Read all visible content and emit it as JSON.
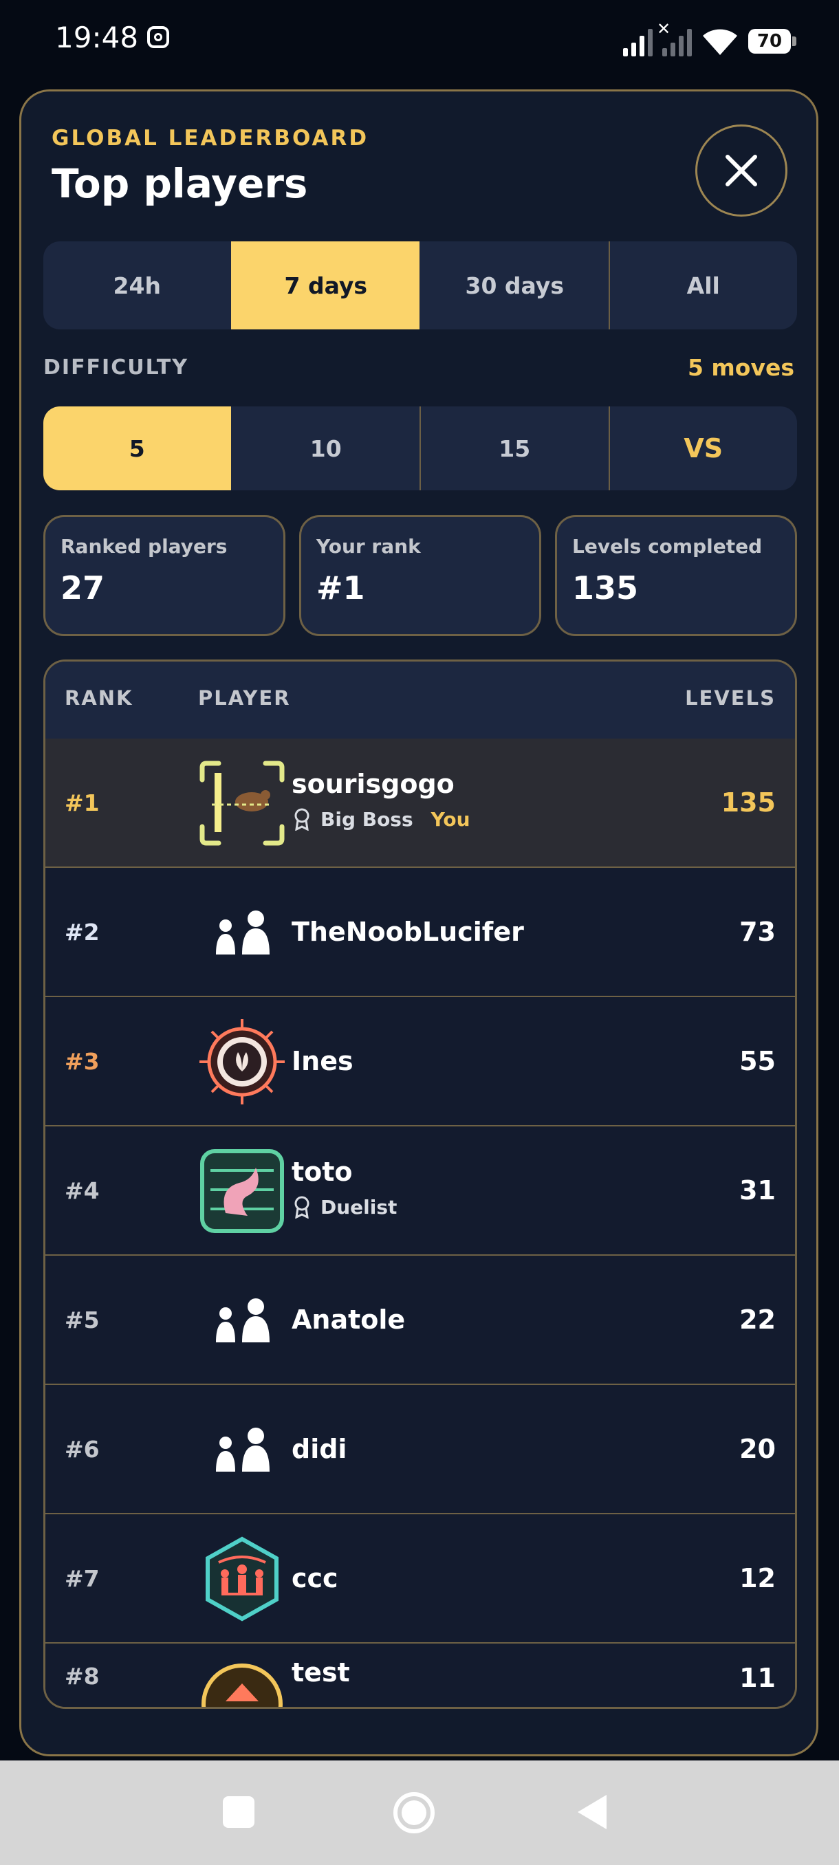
{
  "status_bar": {
    "time": "19:48",
    "battery": "70"
  },
  "header": {
    "kicker": "GLOBAL LEADERBOARD",
    "title": "Top players"
  },
  "time_filter": {
    "options": [
      "24h",
      "7 days",
      "30 days",
      "All"
    ],
    "selected": "7 days"
  },
  "difficulty": {
    "label": "DIFFICULTY",
    "summary": "5 moves",
    "options": [
      "5",
      "10",
      "15",
      "VS"
    ],
    "selected": "5"
  },
  "stats": [
    {
      "label": "Ranked players",
      "value": "27"
    },
    {
      "label": "Your rank",
      "value": "#1"
    },
    {
      "label": "Levels completed",
      "value": "135"
    }
  ],
  "table": {
    "headers": {
      "rank": "RANK",
      "player": "PLAYER",
      "levels": "LEVELS"
    },
    "rows": [
      {
        "rank": "#1",
        "name": "sourisgogo",
        "levels": "135",
        "title": "Big Boss",
        "you": "You",
        "avatar": "mouse-frame-avatar"
      },
      {
        "rank": "#2",
        "name": "TheNoobLucifer",
        "levels": "73",
        "avatar": "default-users-avatar"
      },
      {
        "rank": "#3",
        "name": "Ines",
        "levels": "55",
        "avatar": "sun-badge-avatar"
      },
      {
        "rank": "#4",
        "name": "toto",
        "levels": "31",
        "title": "Duelist",
        "avatar": "dragon-frame-avatar"
      },
      {
        "rank": "#5",
        "name": "Anatole",
        "levels": "22",
        "avatar": "default-users-avatar"
      },
      {
        "rank": "#6",
        "name": "didi",
        "levels": "20",
        "avatar": "default-users-avatar"
      },
      {
        "rank": "#7",
        "name": "ccc",
        "levels": "12",
        "avatar": "hexagon-crown-avatar"
      },
      {
        "rank": "#8",
        "name": "test",
        "levels": "11",
        "avatar": "gold-wheel-avatar"
      }
    ]
  },
  "colors": {
    "accent": "#fbd46b",
    "panel": "#111a2c",
    "border": "#8a7548"
  }
}
